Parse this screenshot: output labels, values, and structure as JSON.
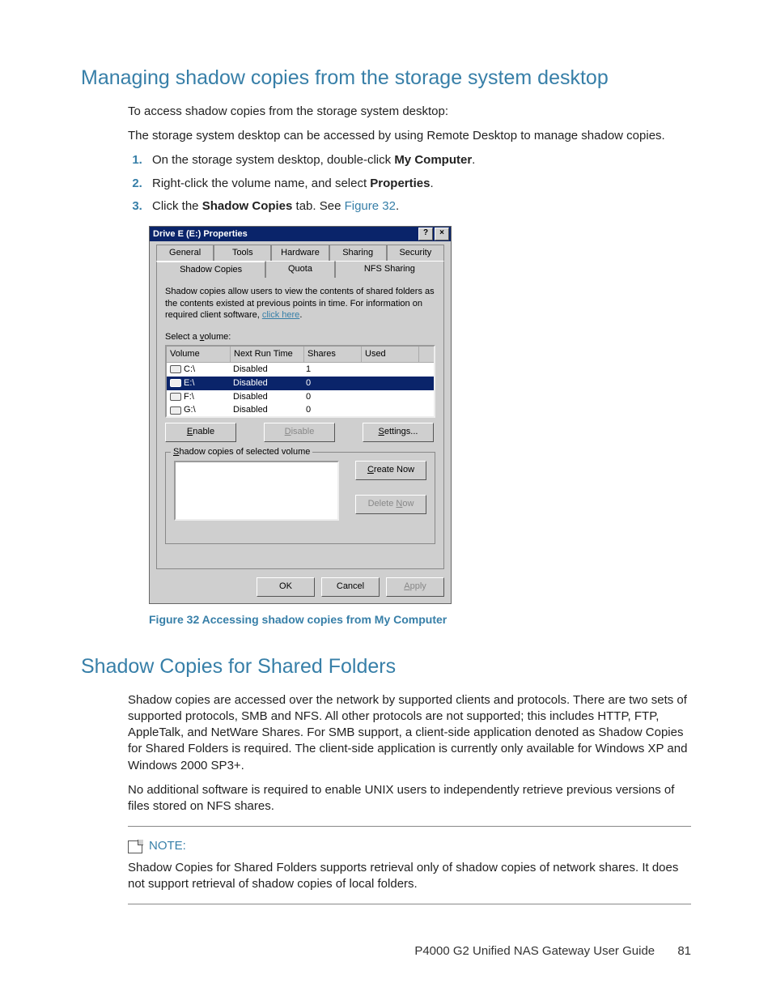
{
  "section1": {
    "title": "Managing shadow copies from the storage system desktop",
    "p1": "To access shadow copies from the storage system desktop:",
    "p2": "The storage system desktop can be accessed by using Remote Desktop to manage shadow copies.",
    "steps": {
      "s1a": "On the storage system desktop, double-click ",
      "s1b": "My Computer",
      "s1c": ".",
      "s2a": "Right-click the volume name, and select ",
      "s2b": "Properties",
      "s2c": ".",
      "s3a": "Click the ",
      "s3b": "Shadow Copies",
      "s3c": " tab. See ",
      "s3link": "Figure 32",
      "s3d": "."
    }
  },
  "dialog": {
    "title": "Drive E (E:) Properties",
    "help": "?",
    "close": "×",
    "tabs_row1": {
      "t1": "General",
      "t2": "Tools",
      "t3": "Hardware",
      "t4": "Sharing",
      "t5": "Security"
    },
    "tabs_row2": {
      "t1": "Shadow Copies",
      "t2": "Quota",
      "t3": "NFS Sharing"
    },
    "intro": "Shadow copies allow users to view the contents of shared folders as the contents existed at previous points in time. For information on required client software, ",
    "intro_link": "click here",
    "intro_end": ".",
    "select_label_pre": "Select a ",
    "select_label_u": "v",
    "select_label_post": "olume:",
    "headers": {
      "vol": "Volume",
      "nrt": "Next Run Time",
      "sh": "Shares",
      "used": "Used"
    },
    "rows": [
      {
        "vol": "C:\\",
        "nrt": "Disabled",
        "sh": "1",
        "used": "",
        "selected": false
      },
      {
        "vol": "E:\\",
        "nrt": "Disabled",
        "sh": "0",
        "used": "",
        "selected": true
      },
      {
        "vol": "F:\\",
        "nrt": "Disabled",
        "sh": "0",
        "used": "",
        "selected": false
      },
      {
        "vol": "G:\\",
        "nrt": "Disabled",
        "sh": "0",
        "used": "",
        "selected": false
      }
    ],
    "btn_enable_u": "E",
    "btn_enable": "nable",
    "btn_disable_u": "D",
    "btn_disable": "isable",
    "btn_settings_u": "S",
    "btn_settings": "ettings...",
    "groupbox_u": "S",
    "groupbox": "hadow copies of selected volume",
    "btn_create_u": "C",
    "btn_create": "reate Now",
    "btn_delete_pre": "Delete ",
    "btn_delete_u": "N",
    "btn_delete": "ow",
    "ok": "OK",
    "cancel": "Cancel",
    "apply_u": "A",
    "apply": "pply"
  },
  "figure_caption": "Figure 32 Accessing shadow copies from My Computer",
  "section2": {
    "title": "Shadow Copies for Shared Folders",
    "p1": "Shadow copies are accessed over the network by supported clients and protocols. There are two sets of supported protocols, SMB and NFS. All other protocols are not supported; this includes HTTP, FTP, AppleTalk, and NetWare Shares. For SMB support, a client-side application denoted as Shadow Copies for Shared Folders is required. The client-side application is currently only available for Windows XP and Windows 2000 SP3+.",
    "p2": "No additional software is required to enable UNIX users to independently retrieve previous versions of files stored on NFS shares."
  },
  "note": {
    "label": "NOTE:",
    "text": "Shadow Copies for Shared Folders supports retrieval only of shadow copies of network shares. It does not support retrieval of shadow copies of local folders."
  },
  "footer": {
    "doc": "P4000 G2 Unified NAS Gateway User Guide",
    "page": "81"
  }
}
